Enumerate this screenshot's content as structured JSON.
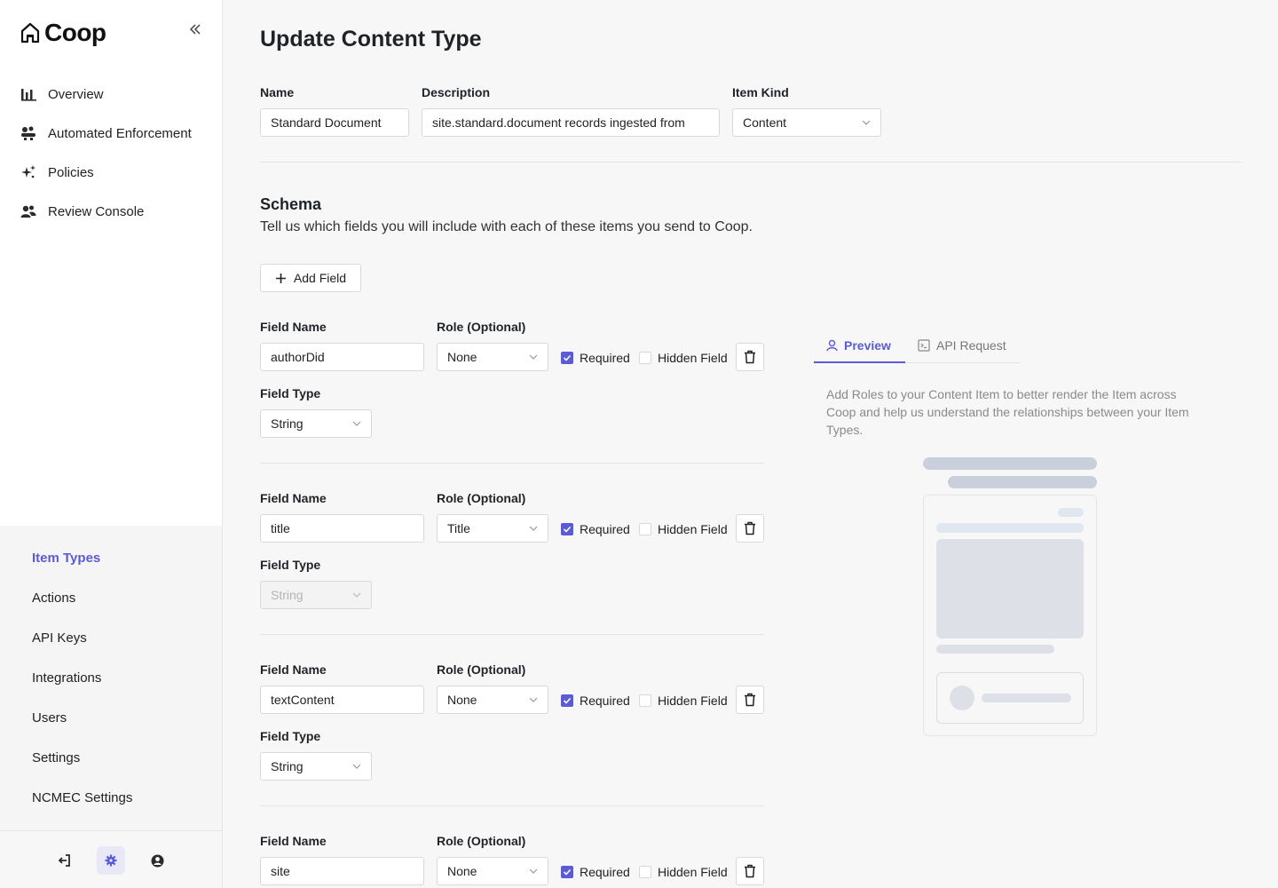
{
  "app": {
    "name": "Coop"
  },
  "sidebar": {
    "nav": [
      {
        "label": "Overview",
        "icon": "bar-chart-icon"
      },
      {
        "label": "Automated Enforcement",
        "icon": "enforcement-icon"
      },
      {
        "label": "Policies",
        "icon": "sparkles-icon"
      },
      {
        "label": "Review Console",
        "icon": "users-icon"
      }
    ],
    "settings": [
      {
        "label": "Item Types",
        "active": true
      },
      {
        "label": "Actions"
      },
      {
        "label": "API Keys"
      },
      {
        "label": "Integrations"
      },
      {
        "label": "Users"
      },
      {
        "label": "Settings"
      },
      {
        "label": "NCMEC Settings"
      }
    ]
  },
  "page": {
    "title": "Update Content Type",
    "name_label": "Name",
    "name_value": "Standard Document",
    "description_label": "Description",
    "description_value": "site.standard.document records ingested from",
    "item_kind_label": "Item Kind",
    "item_kind_value": "Content"
  },
  "schema": {
    "title": "Schema",
    "description": "Tell us which fields you will include with each of these items you send to Coop.",
    "add_field_label": "Add Field",
    "field_name_label": "Field Name",
    "role_label": "Role (Optional)",
    "field_type_label": "Field Type",
    "required_label": "Required",
    "hidden_label": "Hidden Field",
    "fields": [
      {
        "name": "authorDid",
        "role": "None",
        "type": "String",
        "required": true,
        "hidden": false,
        "type_disabled": false
      },
      {
        "name": "title",
        "role": "Title",
        "type": "String",
        "required": true,
        "hidden": false,
        "type_disabled": true
      },
      {
        "name": "textContent",
        "role": "None",
        "type": "String",
        "required": true,
        "hidden": false,
        "type_disabled": false
      },
      {
        "name": "site",
        "role": "None",
        "required": true,
        "hidden": false
      }
    ]
  },
  "preview": {
    "tabs": [
      {
        "label": "Preview",
        "active": true
      },
      {
        "label": "API Request",
        "active": false
      }
    ],
    "description": "Add Roles to your Content Item to better render the Item across Coop and help us understand the relationships between your Item Types."
  },
  "colors": {
    "accent": "#5b5bd6",
    "skeleton": "#c9d0db",
    "skeleton_light": "#e1e7f0"
  }
}
